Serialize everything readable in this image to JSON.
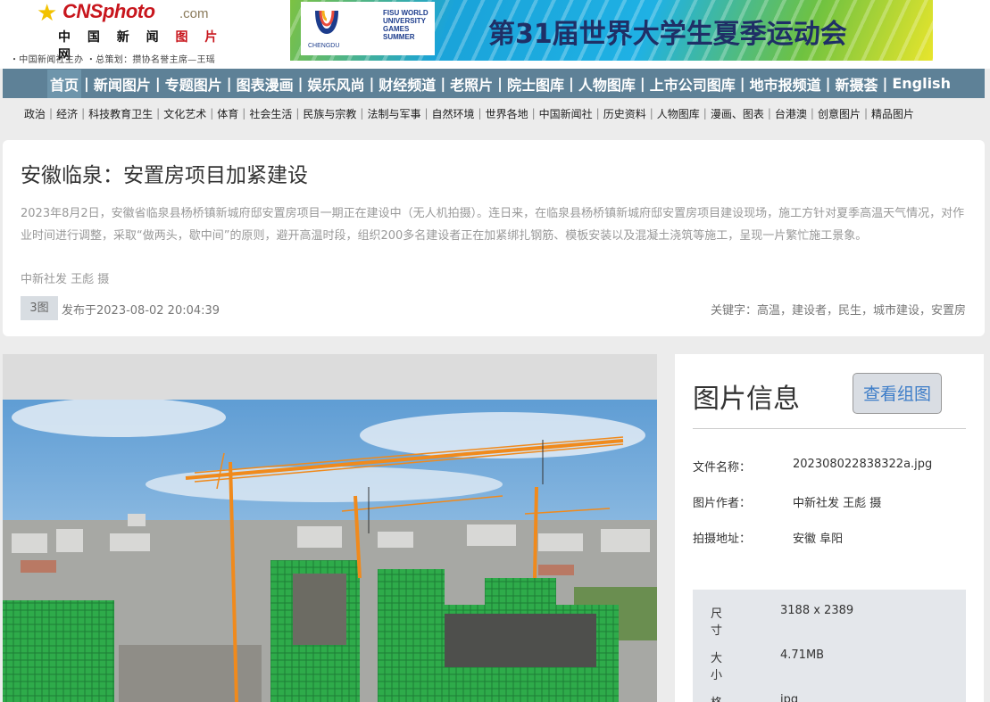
{
  "header": {
    "logo": {
      "brand": "CNSphoto",
      "dotcom": ".com",
      "cn_name_parts": [
        "中 国 新 闻 ",
        "图 片",
        " 网"
      ],
      "tagline": "・中国新闻社主办  ・总策划：攒协名誉主席—王瑶"
    },
    "banner": {
      "city": "CHENGDU",
      "fisu": "FISU WORLD UNIVERSITY GAMES SUMMER",
      "title": "第31届世界大学生夏季运动会"
    }
  },
  "nav": {
    "items": [
      "首页",
      "新闻图片",
      "专题图片",
      "图表漫画",
      "娱乐风尚",
      "财经频道",
      "老照片",
      "院士图库",
      "人物图库",
      "上市公司图库",
      "地市报频道",
      "新摄荟",
      "English"
    ],
    "separator": "|"
  },
  "subnav": {
    "items": [
      "政治",
      "经济",
      "科技教育卫生",
      "文化艺术",
      "体育",
      "社会生活",
      "民族与宗教",
      "法制与军事",
      "自然环境",
      "世界各地",
      "中国新闻社",
      "历史资料",
      "人物图库",
      "漫画、图表",
      "台港澳",
      "创意图片",
      "精品图片"
    ],
    "separator": "|"
  },
  "article": {
    "title": "安徽临泉：安置房项目加紧建设",
    "description": "2023年8月2日，安徽省临泉县杨桥镇新城府邸安置房项目一期正在建设中（无人机拍摄）。连日来，在临泉县杨桥镇新城府邸安置房项目建设现场，施工方针对夏季高温天气情况，对作业时间进行调整，采取“做两头，歇中间”的原则，避开高温时段，组织200多名建设者正在加紧绑扎钢筋、模板安装以及混凝土浇筑等施工，呈现一片繁忙施工景象。",
    "credit": "中新社发 王彪 摄",
    "photo_count": "3图",
    "published": "发布于2023-08-02 20:04:39",
    "keywords": "关键字：高温，建设者，民生，城市建设，安置房"
  },
  "info": {
    "title": "图片信息",
    "group_button": "查看组图",
    "rows": [
      {
        "key": "文件名称：",
        "value": "202308022838322a.jpg"
      },
      {
        "key": "图片作者：",
        "value": "中新社发 王彪 摄"
      },
      {
        "key": "拍摄地址：",
        "value": "安徽 阜阳"
      }
    ],
    "spec": [
      {
        "key": "尺寸",
        "value": "3188 x 2389"
      },
      {
        "key": "大小",
        "value": "4.71MB"
      },
      {
        "key": "格式",
        "value": "jpg"
      }
    ]
  },
  "colors": {
    "nav_bg": "#5e8197",
    "nav_active": "#6e95ab",
    "brand_red": "#c8161d",
    "link_blue": "#3d7dc8",
    "scaffold_green": "#2eab4a",
    "crane_orange": "#f08a1c"
  },
  "icons": {
    "logo_star": "star-icon",
    "universiade_mark": "chengdu-universiade-mark-icon"
  }
}
